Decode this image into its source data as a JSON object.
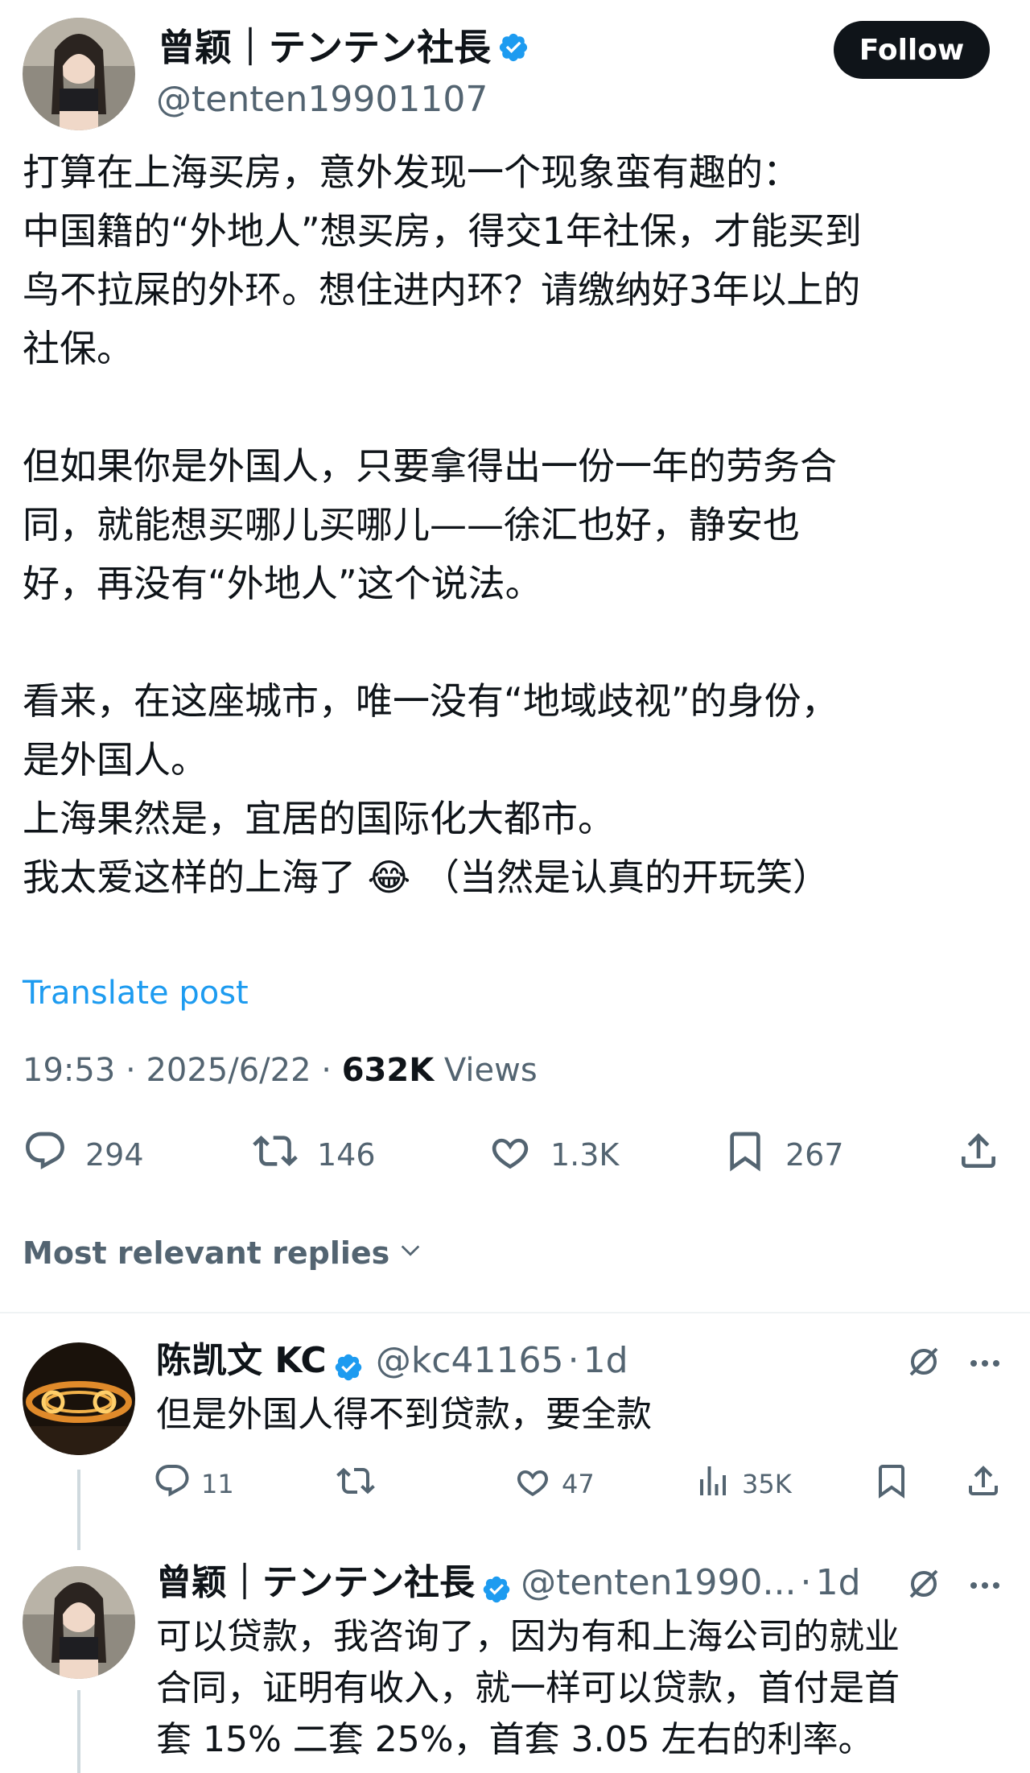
{
  "colors": {
    "accent": "#1d9bf0",
    "text": "#0f1419",
    "muted": "#536471",
    "divider": "#eff3f4"
  },
  "tweet": {
    "author_name": "曾颖｜テンテン社長",
    "author_handle": "@tenten19901107",
    "follow_label": "Follow",
    "text": "打算在上海买房，意外发现一个现象蛮有趣的：\n中国籍的“外地人”想买房，得交1年社保，才能买到\n鸟不拉屎的外环。想住进内环？请缴纳好3年以上的\n社保。\n\n但如果你是外国人，只要拿得出一份一年的劳务合\n同，就能想买哪儿买哪儿——徐汇也好，静安也\n好，再没有“外地人”这个说法。\n\n看来，在这座城市，唯一没有“地域歧视”的身份，\n是外国人。\n上海果然是，宜居的国际化大都市。\n我太爱这样的上海了 😂 （当然是认真的开玩笑）",
    "translate_label": "Translate post",
    "time": "19:53",
    "date": "2025/6/22",
    "views_count": "632K",
    "views_label": "Views",
    "stats": {
      "replies": "294",
      "reposts": "146",
      "likes": "1.3K",
      "bookmarks": "267"
    }
  },
  "replies_header": {
    "sort_label": "Most relevant replies"
  },
  "replies": [
    {
      "author_name": "陈凯文 KC",
      "author_handle": "@kc41165",
      "time": "1d",
      "text": "但是外国人得不到贷款，要全款",
      "stats": {
        "replies": "11",
        "reposts": "",
        "likes": "47",
        "views": "35K"
      }
    },
    {
      "author_name": "曾颖｜テンテン社長",
      "author_handle": "@tenten1990...",
      "time": "1d",
      "text": "可以贷款，我咨询了，因为有和上海公司的就业\n合同，证明有收入，就一样可以贷款，首付是首\n套 15% 二套 25%，首套 3.05 左右的利率。"
    }
  ],
  "icons": [
    "verified-badge-icon",
    "reply-icon",
    "repost-icon",
    "like-icon",
    "bookmark-icon",
    "share-icon",
    "chevron-down-icon",
    "grok-icon",
    "more-icon",
    "analytics-icon"
  ]
}
